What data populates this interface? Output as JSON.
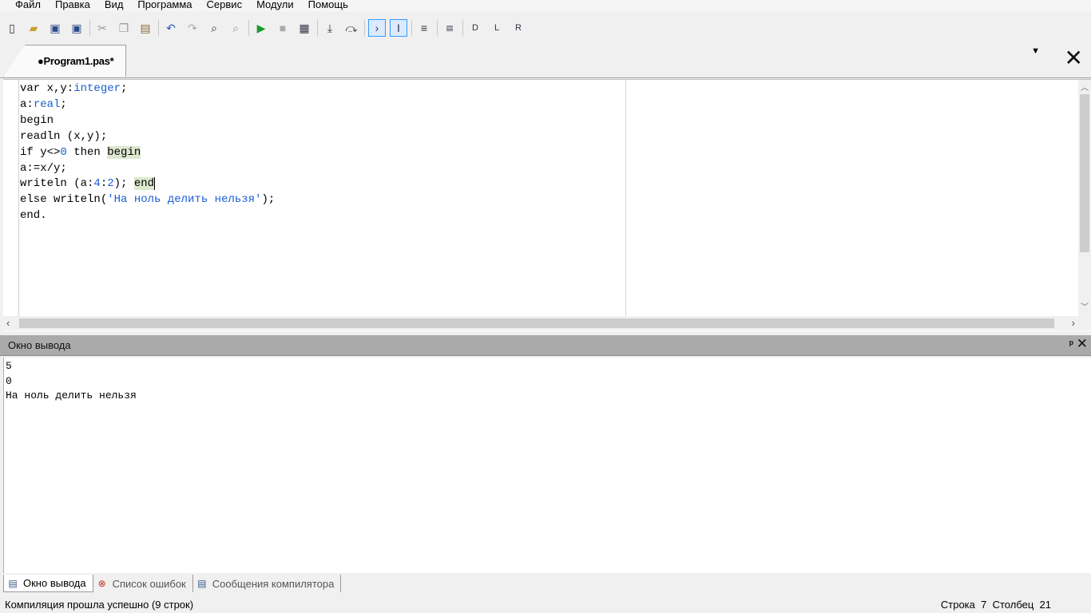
{
  "menu": [
    "Файл",
    "Правка",
    "Вид",
    "Программа",
    "Сервис",
    "Модули",
    "Помощь"
  ],
  "toolbar": {
    "icons": [
      "new-file-icon",
      "open-folder-icon",
      "save-icon",
      "save-all-icon",
      "cut-icon",
      "copy-icon",
      "paste-icon",
      "undo-icon",
      "redo-icon",
      "find-icon",
      "find-next-icon",
      "run-icon",
      "stop-icon",
      "debug-icon",
      "step-into-icon",
      "step-over-icon",
      "console-icon",
      "output-toggle-icon",
      "format-icon",
      "code-template-icon",
      "module-d-icon",
      "module-l-icon",
      "module-r-icon"
    ]
  },
  "tab": {
    "title": "●Program1.pas*"
  },
  "code": {
    "l1_a": "var x,y:",
    "l1_b": "integer",
    "l1_c": ";",
    "l2_a": "a:",
    "l2_b": "real",
    "l2_c": ";",
    "l3": "begin",
    "l4": "readln (x,y);",
    "l5_a": "if y<>",
    "l5_b": "0",
    "l5_c": " then ",
    "l5_d": "begin",
    "l6": "a:=x/y;",
    "l7_a": "writeln (a:",
    "l7_b": "4",
    "l7_c": ":",
    "l7_d": "2",
    "l7_e": "); ",
    "l7_f": "end",
    "l8_a": "else writeln(",
    "l8_b": "'На ноль делить нельзя'",
    "l8_c": ");",
    "l9": "end."
  },
  "output_panel": {
    "title": "Окно вывода",
    "lines": [
      "5",
      "0",
      "На ноль делить нельзя"
    ]
  },
  "bottom_tabs": [
    "Окно вывода",
    "Список ошибок",
    "Сообщения компилятора"
  ],
  "status": {
    "message": "Компиляция прошла успешно (9 строк)",
    "line_label": "Строка",
    "line_value": "7",
    "col_label": "Столбец",
    "col_value": "21"
  },
  "colors": {
    "accent": "#3399ff",
    "code_blue": "#1a5fd6",
    "highlight": "#dde8d0",
    "panel_header": "#aaaaaa"
  }
}
